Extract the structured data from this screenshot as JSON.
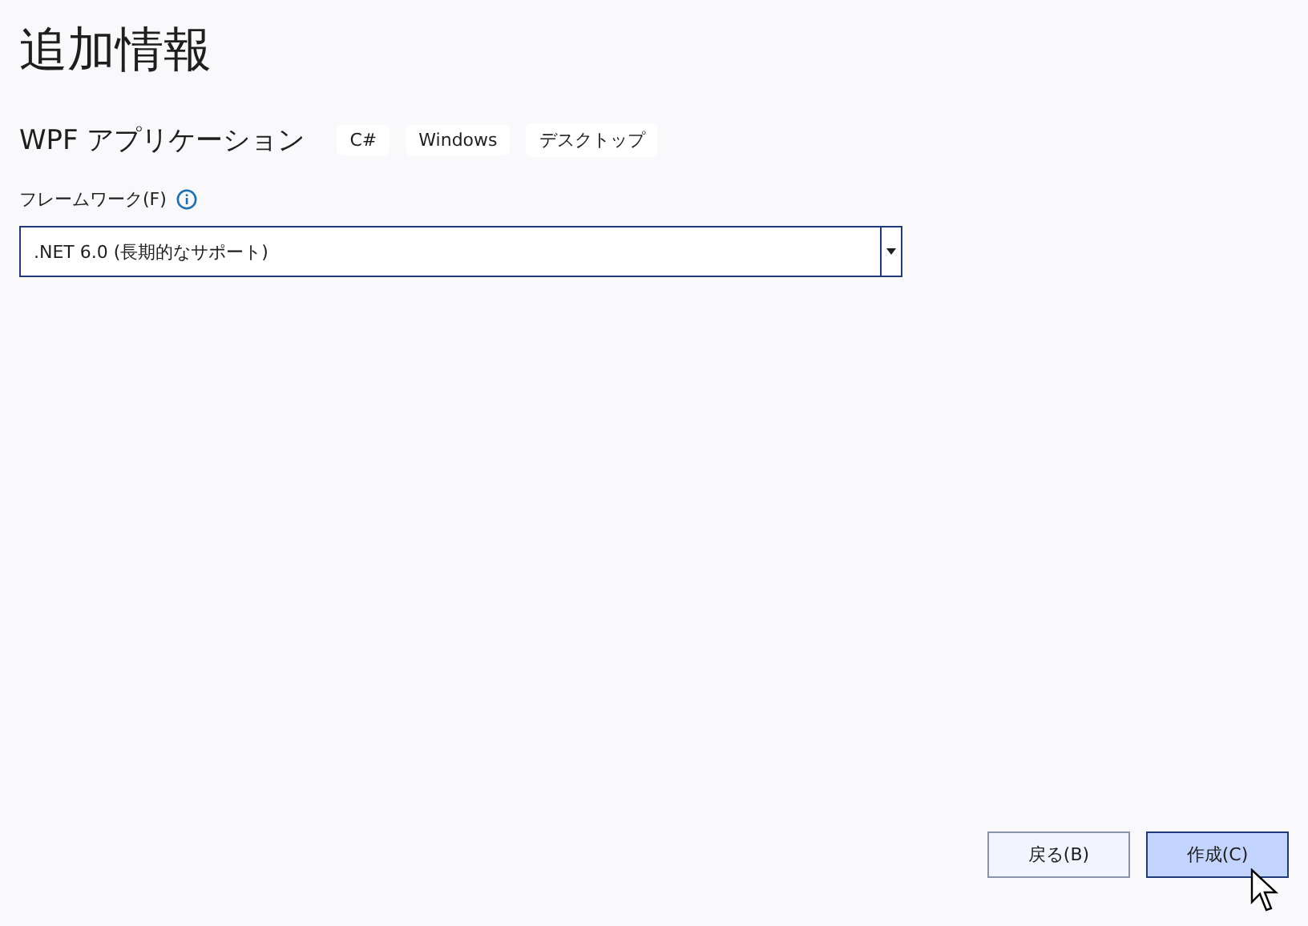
{
  "title": "追加情報",
  "template": {
    "name": "WPF アプリケーション",
    "tags": [
      "C#",
      "Windows",
      "デスクトップ"
    ]
  },
  "framework": {
    "label": "フレームワーク(F)",
    "value": ".NET 6.0 (長期的なサポート)"
  },
  "buttons": [
    {
      "label": "戻る(B)",
      "kind": "secondary"
    },
    {
      "label": "作成(C)",
      "kind": "primary"
    }
  ]
}
